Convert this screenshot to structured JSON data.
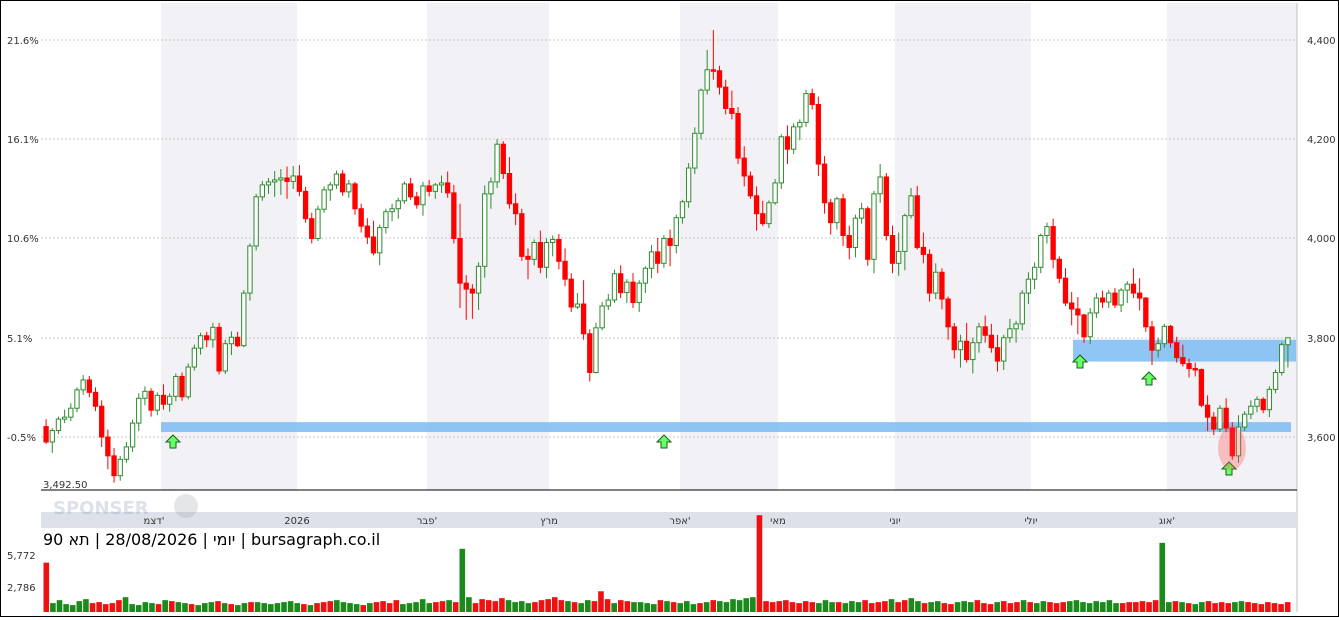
{
  "chart_data": {
    "type": "candlestick",
    "title": "יומי | 28/08/2026 | תא 90 | bursagraph.co.il",
    "y_left_ticks": [
      "21.6%",
      "16.1%",
      "10.6%",
      "5.1%",
      "-0.5%"
    ],
    "y_right_ticks": [
      "4,400",
      "4,200",
      "4,000",
      "3,800",
      "3,600"
    ],
    "ylim": [
      3492.5,
      4430
    ],
    "base_label": "3,492.50",
    "months": [
      "דצמ'",
      "2026",
      "פבר'",
      "מרץ",
      "אפר'",
      "מאי",
      "יוני",
      "יולי",
      "אוג'"
    ],
    "volume_ticks": [
      "5,772",
      "2,786"
    ],
    "volume_max": 8000,
    "colors": {
      "up": "#2e8b2e",
      "down": "#ff0000",
      "zone": "#7bbcf2",
      "band": "#f2f2f6",
      "signal": "#66ff66"
    },
    "candles": [
      [
        3621,
        3636,
        3586,
        3590
      ],
      [
        3590,
        3618,
        3568,
        3613
      ],
      [
        3613,
        3641,
        3606,
        3636
      ],
      [
        3636,
        3655,
        3628,
        3640
      ],
      [
        3640,
        3668,
        3632,
        3658
      ],
      [
        3658,
        3700,
        3650,
        3695
      ],
      [
        3695,
        3725,
        3685,
        3715
      ],
      [
        3715,
        3723,
        3680,
        3690
      ],
      [
        3690,
        3700,
        3652,
        3662
      ],
      [
        3662,
        3674,
        3580,
        3600
      ],
      [
        3600,
        3615,
        3535,
        3562
      ],
      [
        3562,
        3578,
        3508,
        3522
      ],
      [
        3522,
        3562,
        3512,
        3555
      ],
      [
        3555,
        3590,
        3548,
        3580
      ],
      [
        3580,
        3635,
        3570,
        3628
      ],
      [
        3628,
        3688,
        3612,
        3678
      ],
      [
        3678,
        3702,
        3664,
        3692
      ],
      [
        3692,
        3698,
        3641,
        3654
      ],
      [
        3654,
        3690,
        3644,
        3684
      ],
      [
        3684,
        3706,
        3655,
        3666
      ],
      [
        3666,
        3688,
        3651,
        3682
      ],
      [
        3682,
        3728,
        3672,
        3722
      ],
      [
        3722,
        3730,
        3673,
        3681
      ],
      [
        3681,
        3748,
        3676,
        3741
      ],
      [
        3741,
        3786,
        3734,
        3779
      ],
      [
        3779,
        3810,
        3766,
        3804
      ],
      [
        3804,
        3812,
        3781,
        3796
      ],
      [
        3796,
        3830,
        3780,
        3821
      ],
      [
        3821,
        3830,
        3726,
        3733
      ],
      [
        3733,
        3796,
        3727,
        3788
      ],
      [
        3788,
        3813,
        3765,
        3801
      ],
      [
        3801,
        3812,
        3781,
        3784
      ],
      [
        3784,
        3896,
        3781,
        3890
      ],
      [
        3890,
        3990,
        3875,
        3985
      ],
      [
        3985,
        4090,
        3976,
        4084
      ],
      [
        4084,
        4116,
        4076,
        4108
      ],
      [
        4108,
        4122,
        4090,
        4114
      ],
      [
        4114,
        4136,
        4084,
        4118
      ],
      [
        4118,
        4140,
        4088,
        4122
      ],
      [
        4122,
        4145,
        4080,
        4115
      ],
      [
        4115,
        4146,
        4100,
        4126
      ],
      [
        4126,
        4148,
        4085,
        4095
      ],
      [
        4095,
        4104,
        4032,
        4040
      ],
      [
        4040,
        4052,
        3990,
        4000
      ],
      [
        4000,
        4066,
        3995,
        4059
      ],
      [
        4059,
        4105,
        4052,
        4098
      ],
      [
        4098,
        4114,
        4076,
        4108
      ],
      [
        4108,
        4137,
        4100,
        4130
      ],
      [
        4130,
        4138,
        4086,
        4094
      ],
      [
        4094,
        4118,
        4082,
        4110
      ],
      [
        4110,
        4114,
        4048,
        4060
      ],
      [
        4060,
        4070,
        4012,
        4025
      ],
      [
        4025,
        4041,
        3989,
        4003
      ],
      [
        4003,
        4036,
        3966,
        3971
      ],
      [
        3971,
        4028,
        3946,
        4022
      ],
      [
        4022,
        4060,
        4010,
        4054
      ],
      [
        4054,
        4070,
        4035,
        4060
      ],
      [
        4060,
        4082,
        4040,
        4076
      ],
      [
        4076,
        4115,
        4070,
        4110
      ],
      [
        4110,
        4122,
        4078,
        4084
      ],
      [
        4084,
        4094,
        4060,
        4068
      ],
      [
        4068,
        4114,
        4046,
        4106
      ],
      [
        4106,
        4118,
        4085,
        4095
      ],
      [
        4095,
        4112,
        4080,
        4108
      ],
      [
        4108,
        4127,
        4092,
        4112
      ],
      [
        4112,
        4135,
        4082,
        4092
      ],
      [
        4092,
        4108,
        3990,
        4000
      ],
      [
        4000,
        4070,
        3860,
        3910
      ],
      [
        3910,
        3926,
        3836,
        3898
      ],
      [
        3898,
        3908,
        3838,
        3890
      ],
      [
        3890,
        3952,
        3856,
        3944
      ],
      [
        3944,
        4107,
        3921,
        4090
      ],
      [
        4090,
        4123,
        4060,
        4114
      ],
      [
        4114,
        4200,
        4102,
        4190
      ],
      [
        4190,
        4196,
        4120,
        4131
      ],
      [
        4131,
        4164,
        4060,
        4070
      ],
      [
        4070,
        4091,
        4027,
        4050
      ],
      [
        4050,
        4060,
        3955,
        3964
      ],
      [
        3964,
        3980,
        3918,
        3958
      ],
      [
        3958,
        3998,
        3946,
        3992
      ],
      [
        3992,
        4016,
        3930,
        3942
      ],
      [
        3942,
        4000,
        3920,
        3992
      ],
      [
        3992,
        4006,
        3964,
        3998
      ],
      [
        3998,
        4009,
        3938,
        3954
      ],
      [
        3954,
        3980,
        3904,
        3918
      ],
      [
        3918,
        3930,
        3852,
        3862
      ],
      [
        3862,
        3890,
        3858,
        3868
      ],
      [
        3868,
        3916,
        3796,
        3808
      ],
      [
        3808,
        3817,
        3712,
        3730
      ],
      [
        3730,
        3830,
        3728,
        3820
      ],
      [
        3820,
        3872,
        3815,
        3864
      ],
      [
        3864,
        3888,
        3856,
        3876
      ],
      [
        3876,
        3937,
        3870,
        3929
      ],
      [
        3929,
        3946,
        3880,
        3891
      ],
      [
        3891,
        3918,
        3870,
        3912
      ],
      [
        3912,
        3930,
        3860,
        3871
      ],
      [
        3871,
        3916,
        3852,
        3910
      ],
      [
        3910,
        3944,
        3890,
        3940
      ],
      [
        3940,
        3987,
        3920,
        3973
      ],
      [
        3973,
        4001,
        3930,
        3950
      ],
      [
        3950,
        4007,
        3941,
        4000
      ],
      [
        4000,
        4018,
        3944,
        3986
      ],
      [
        3986,
        4048,
        3970,
        4042
      ],
      [
        4042,
        4078,
        4030,
        4074
      ],
      [
        4074,
        4152,
        4062,
        4142
      ],
      [
        4142,
        4224,
        4130,
        4212
      ],
      [
        4212,
        4302,
        4200,
        4299
      ],
      [
        4299,
        4380,
        4290,
        4340
      ],
      [
        4340,
        4420,
        4320,
        4338
      ],
      [
        4338,
        4348,
        4290,
        4305
      ],
      [
        4305,
        4320,
        4250,
        4262
      ],
      [
        4262,
        4298,
        4240,
        4252
      ],
      [
        4252,
        4265,
        4150,
        4162
      ],
      [
        4162,
        4186,
        4105,
        4126
      ],
      [
        4126,
        4135,
        4080,
        4086
      ],
      [
        4086,
        4105,
        4016,
        4050
      ],
      [
        4050,
        4076,
        4025,
        4030
      ],
      [
        4030,
        4077,
        4021,
        4072
      ],
      [
        4072,
        4120,
        4068,
        4112
      ],
      [
        4112,
        4210,
        4100,
        4205
      ],
      [
        4205,
        4228,
        4150,
        4180
      ],
      [
        4180,
        4232,
        4170,
        4225
      ],
      [
        4225,
        4240,
        4198,
        4234
      ],
      [
        4234,
        4300,
        4225,
        4292
      ],
      [
        4292,
        4302,
        4260,
        4270
      ],
      [
        4270,
        4286,
        4126,
        4150
      ],
      [
        4150,
        4166,
        4050,
        4072
      ],
      [
        4072,
        4080,
        4008,
        4032
      ],
      [
        4032,
        4084,
        4018,
        4080
      ],
      [
        4080,
        4090,
        3985,
        4006
      ],
      [
        4006,
        4026,
        3958,
        3982
      ],
      [
        3982,
        4048,
        3962,
        4041
      ],
      [
        4041,
        4072,
        4030,
        4060
      ],
      [
        4060,
        4065,
        3945,
        3958
      ],
      [
        3958,
        4096,
        3930,
        4090
      ],
      [
        4090,
        4150,
        4072,
        4124
      ],
      [
        4124,
        4132,
        3996,
        4006
      ],
      [
        4006,
        4026,
        3930,
        3950
      ],
      [
        3950,
        4012,
        3925,
        3974
      ],
      [
        3974,
        4050,
        3936,
        4046
      ],
      [
        4046,
        4102,
        4040,
        4086
      ],
      [
        4086,
        4106,
        3978,
        3982
      ],
      [
        3982,
        4012,
        3950,
        3968
      ],
      [
        3968,
        3978,
        3873,
        3890
      ],
      [
        3890,
        3950,
        3878,
        3932
      ],
      [
        3932,
        3940,
        3857,
        3878
      ],
      [
        3878,
        3883,
        3796,
        3822
      ],
      [
        3822,
        3830,
        3758,
        3776
      ],
      [
        3776,
        3806,
        3740,
        3793
      ],
      [
        3793,
        3830,
        3750,
        3756
      ],
      [
        3756,
        3800,
        3728,
        3790
      ],
      [
        3790,
        3830,
        3770,
        3822
      ],
      [
        3822,
        3845,
        3790,
        3805
      ],
      [
        3805,
        3828,
        3770,
        3780
      ],
      [
        3780,
        3806,
        3732,
        3753
      ],
      [
        3753,
        3806,
        3735,
        3800
      ],
      [
        3800,
        3838,
        3790,
        3818
      ],
      [
        3818,
        3834,
        3790,
        3828
      ],
      [
        3828,
        3896,
        3815,
        3890
      ],
      [
        3890,
        3932,
        3868,
        3918
      ],
      [
        3918,
        3952,
        3898,
        3942
      ],
      [
        3942,
        4010,
        3930,
        4006
      ],
      [
        4006,
        4032,
        3990,
        4024
      ],
      [
        4024,
        4040,
        3940,
        3958
      ],
      [
        3958,
        3964,
        3910,
        3920
      ],
      [
        3920,
        3940,
        3864,
        3870
      ],
      [
        3870,
        3892,
        3825,
        3858
      ],
      [
        3858,
        3882,
        3807,
        3846
      ],
      [
        3846,
        3848,
        3790,
        3802
      ],
      [
        3802,
        3860,
        3787,
        3850
      ],
      [
        3850,
        3890,
        3840,
        3880
      ],
      [
        3880,
        3895,
        3860,
        3872
      ],
      [
        3872,
        3896,
        3860,
        3890
      ],
      [
        3890,
        3900,
        3860,
        3866
      ],
      [
        3866,
        3900,
        3852,
        3896
      ],
      [
        3896,
        3914,
        3870,
        3908
      ],
      [
        3908,
        3940,
        3880,
        3890
      ],
      [
        3890,
        3920,
        3855,
        3880
      ],
      [
        3880,
        3882,
        3812,
        3822
      ],
      [
        3822,
        3834,
        3745,
        3775
      ],
      [
        3775,
        3800,
        3760,
        3788
      ],
      [
        3788,
        3828,
        3780,
        3823
      ],
      [
        3823,
        3826,
        3780,
        3790
      ],
      [
        3790,
        3802,
        3750,
        3760
      ],
      [
        3760,
        3786,
        3742,
        3748
      ],
      [
        3748,
        3758,
        3720,
        3738
      ],
      [
        3738,
        3750,
        3722,
        3736
      ],
      [
        3736,
        3738,
        3660,
        3664
      ],
      [
        3664,
        3684,
        3612,
        3640
      ],
      [
        3640,
        3650,
        3604,
        3616
      ],
      [
        3616,
        3664,
        3610,
        3658
      ],
      [
        3658,
        3678,
        3610,
        3618
      ],
      [
        3618,
        3630,
        3554,
        3562
      ],
      [
        3562,
        3644,
        3548,
        3620
      ],
      [
        3620,
        3652,
        3612,
        3646
      ],
      [
        3646,
        3674,
        3636,
        3662
      ],
      [
        3662,
        3682,
        3650,
        3676
      ],
      [
        3676,
        3680,
        3648,
        3655
      ],
      [
        3655,
        3702,
        3640,
        3696
      ],
      [
        3696,
        3736,
        3688,
        3730
      ],
      [
        3730,
        3790,
        3724,
        3786
      ],
      [
        3786,
        3800,
        3740,
        3800
      ]
    ],
    "volumes": [
      5000,
      900,
      1200,
      800,
      700,
      1100,
      1300,
      900,
      1000,
      800,
      900,
      1200,
      1500,
      800,
      700,
      1000,
      900,
      800,
      1200,
      1100,
      1000,
      900,
      800,
      700,
      900,
      1000,
      1100,
      900,
      800,
      700,
      900,
      1000,
      1000,
      900,
      800,
      900,
      1000,
      1100,
      900,
      800,
      700,
      900,
      1000,
      1100,
      1200,
      1000,
      900,
      800,
      700,
      900,
      1000,
      1100,
      900,
      1200,
      800,
      900,
      1000,
      1300,
      900,
      1000,
      1100,
      1200,
      1000,
      6400,
      1500,
      900,
      1300,
      1200,
      1100,
      1400,
      1200,
      1000,
      1100,
      900,
      1000,
      1200,
      1300,
      1500,
      1200,
      1100,
      1000,
      900,
      1200,
      1100,
      2100,
      1300,
      900,
      1200,
      1100,
      1000,
      1000,
      900,
      800,
      1200,
      1100,
      1000,
      900,
      1100,
      800,
      900,
      1000,
      1200,
      1100,
      1000,
      1300,
      1200,
      1400,
      1500,
      9800,
      1100,
      1000,
      1100,
      1200,
      1000,
      900,
      1100,
      1000,
      900,
      1200,
      1000,
      1000,
      900,
      1100,
      1000,
      1200,
      900,
      1000,
      1100,
      1300,
      1000,
      1200,
      1400,
      1100,
      900,
      1000,
      1100,
      900,
      800,
      1000,
      1100,
      1000,
      1200,
      900,
      800,
      1000,
      1100,
      900,
      1000,
      1200,
      1000,
      900,
      1100,
      1000,
      900,
      1000,
      1100,
      1200,
      1000,
      900,
      1100,
      1000,
      1200,
      900,
      900,
      1000,
      1000,
      1100,
      1000,
      1200,
      7000,
      1000,
      1100,
      1000,
      900,
      800,
      1000,
      1100,
      900,
      1000,
      900,
      1000,
      1100,
      1000,
      900,
      800,
      1000,
      900,
      800,
      1000
    ]
  },
  "levels": [
    {
      "price_top": 3630,
      "price_bottom": 3610,
      "x_from": 160,
      "x_to": 1290
    },
    {
      "price_top": 3796,
      "price_bottom": 3752,
      "x_from": 1072,
      "x_to": 1295
    }
  ],
  "signals": [
    {
      "index": 0
    },
    {
      "index": 0
    },
    {
      "index": 0
    },
    {
      "index": 0
    }
  ],
  "watermark": "SPONSER"
}
